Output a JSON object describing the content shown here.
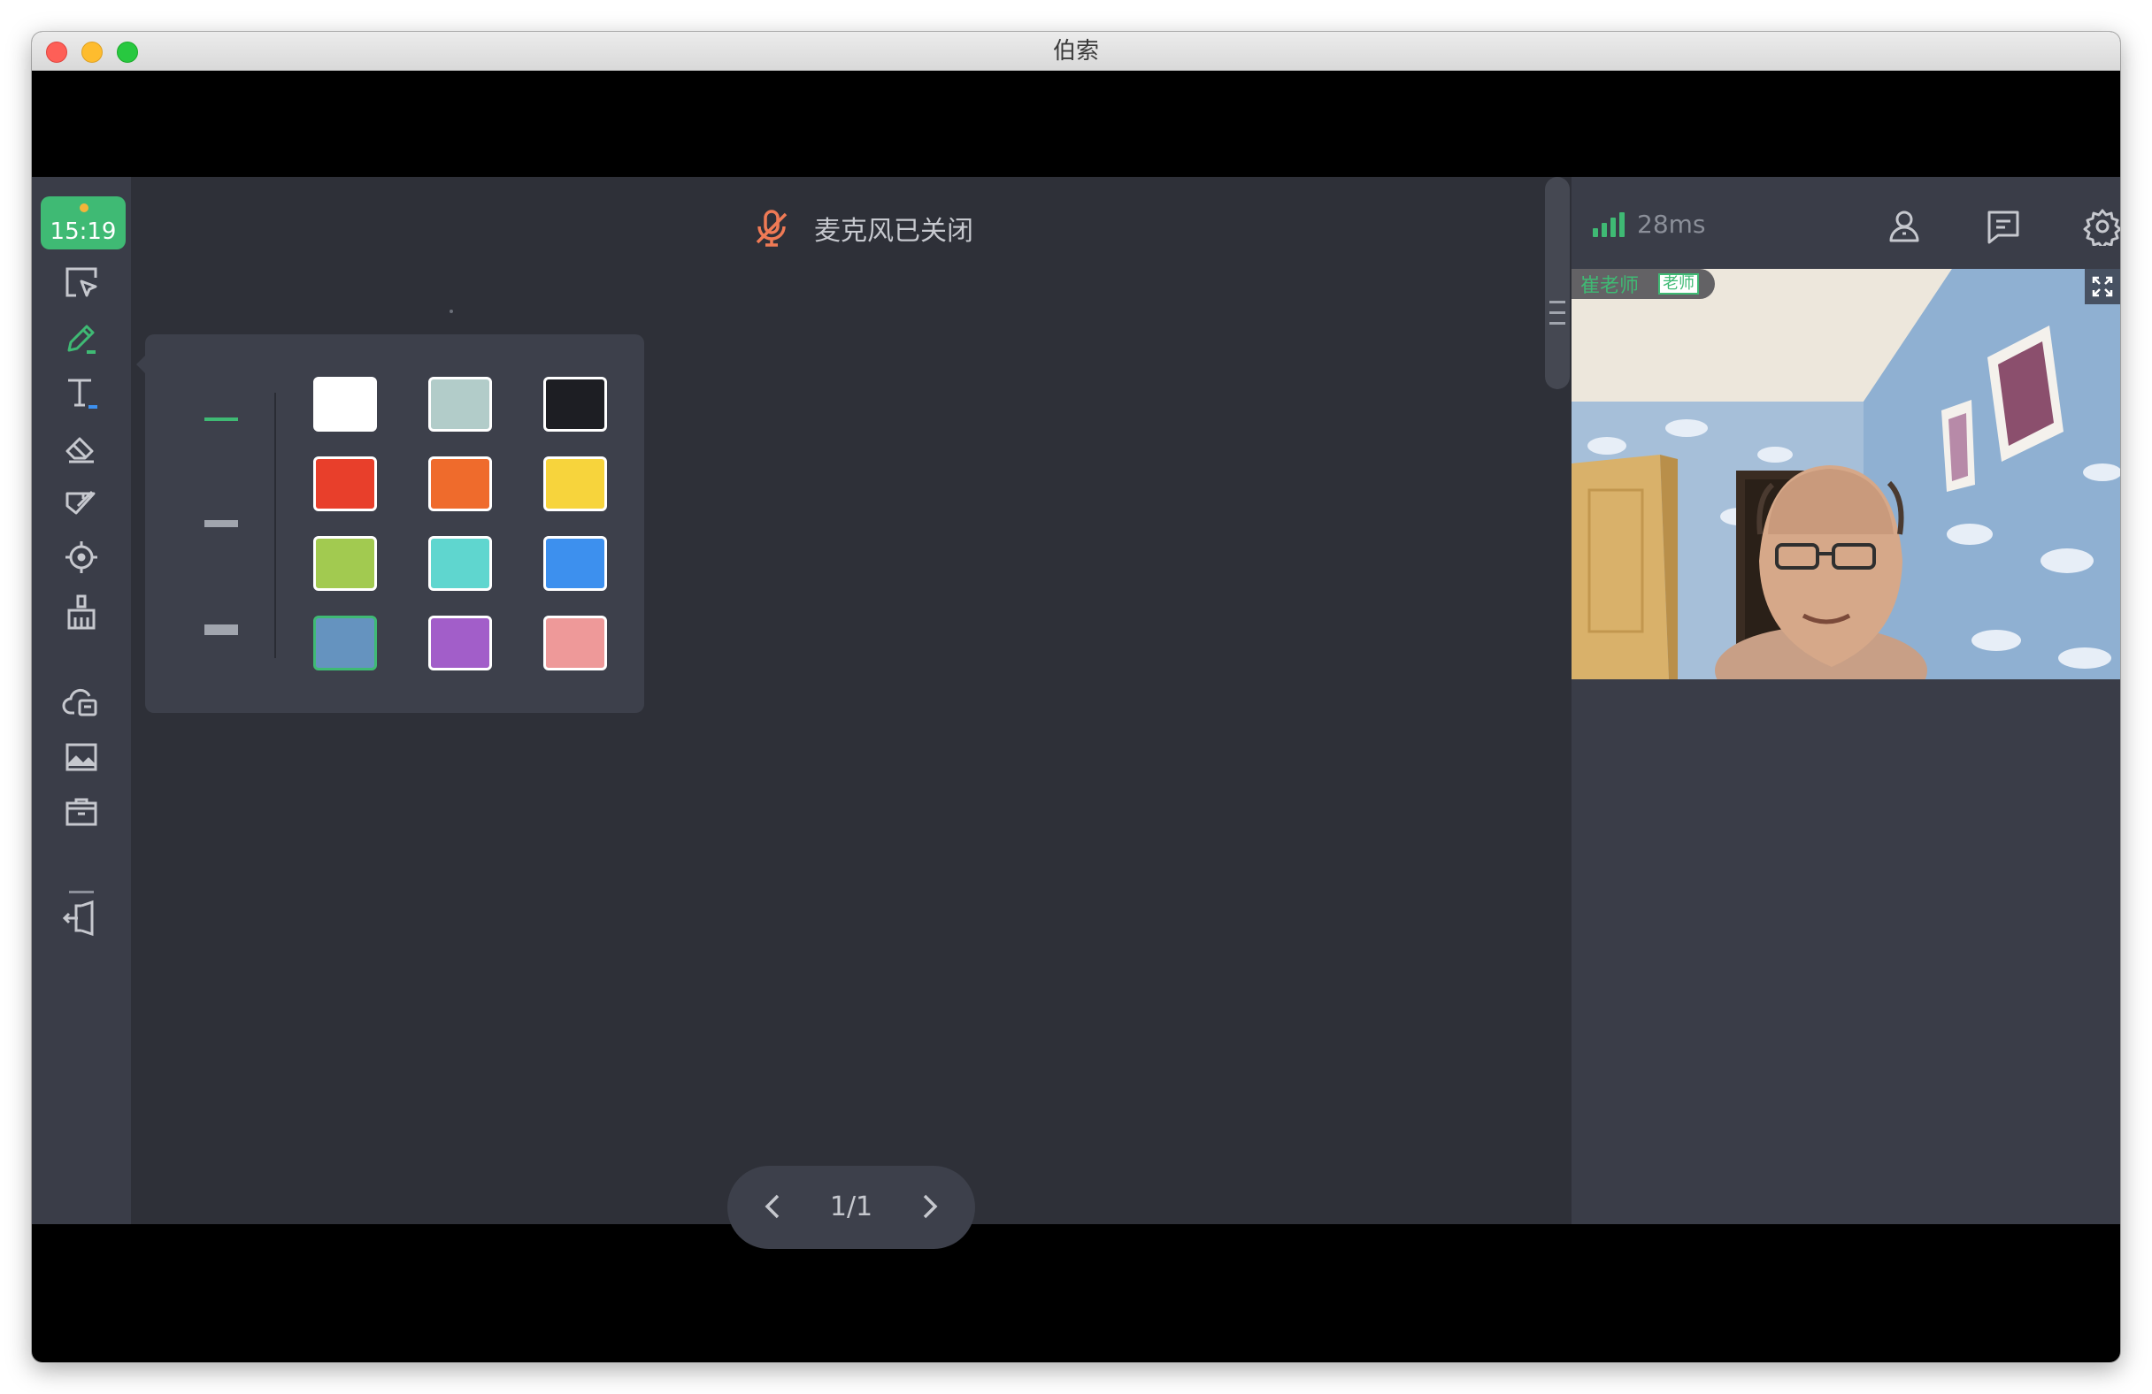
{
  "window": {
    "title": "伯索"
  },
  "toolbar": {
    "clock": "15:19",
    "tools": [
      {
        "name": "select-tool",
        "icon": "select-cursor-icon",
        "active": false
      },
      {
        "name": "pen-tool",
        "icon": "pen-icon",
        "active": true
      },
      {
        "name": "text-tool",
        "icon": "text-icon",
        "active": false
      },
      {
        "name": "eraser-tool",
        "icon": "eraser-icon",
        "active": false
      },
      {
        "name": "shape-tool",
        "icon": "ruler-shape-icon",
        "active": false
      },
      {
        "name": "laser-pointer-tool",
        "icon": "crosshair-icon",
        "active": false
      },
      {
        "name": "clear-tool",
        "icon": "broom-icon",
        "active": false
      },
      {
        "name": "cloud-files-tool",
        "icon": "cloud-file-icon",
        "active": false
      },
      {
        "name": "image-tool",
        "icon": "image-icon",
        "active": false
      },
      {
        "name": "toolbox-tool",
        "icon": "toolbox-icon",
        "active": false
      },
      {
        "name": "exit-tool",
        "icon": "exit-icon",
        "active": false
      }
    ]
  },
  "palette": {
    "stroke_widths": [
      "thin",
      "medium",
      "thick"
    ],
    "selected_stroke": "thin",
    "colors": [
      "#ffffff",
      "#b2ccc9",
      "#1d1e23",
      "#e83f2b",
      "#ef6b2c",
      "#f7d43c",
      "#a2ca50",
      "#5fd6cf",
      "#3d90ee",
      "#6593bf",
      "#a25ec9",
      "#ee9999"
    ],
    "selected_color": "#6593bf",
    "accent": "#3fba74"
  },
  "status": {
    "mic_text": "麦克风已关闭",
    "mic_icon": "mic-off-icon",
    "mic_color": "#ef7a55"
  },
  "pager": {
    "label": "1/1"
  },
  "right_panel": {
    "latency": "28ms",
    "signal_bars": 4,
    "video": {
      "name": "崔老师",
      "role": "老师"
    }
  }
}
